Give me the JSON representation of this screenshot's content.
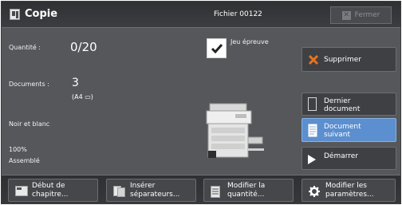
{
  "header": {
    "title": "Copie",
    "file_name": "Fichier 00122",
    "close_label": "Fermer"
  },
  "settings": {
    "quantity_label": "Quantité :",
    "quantity_value": "0/20",
    "documents_label": "Documents :",
    "documents_value": "3",
    "documents_size": "(A4 ▭)",
    "color_mode": "Noir et blanc",
    "zoom": "100%",
    "finishing": "Assemblé",
    "collate_label": "Jeu épreuve",
    "collate_checked": true
  },
  "actions": {
    "delete_label": "Supprimer",
    "last_document_line1": "Dernier",
    "last_document_line2": "document",
    "next_document_line1": "Document",
    "next_document_line2": "suivant",
    "start_label": "Démarrer"
  },
  "bottom": {
    "chapter_start_line1": "Début de",
    "chapter_start_line2": "chapitre...",
    "insert_separators_line1": "Insérer",
    "insert_separators_line2": "séparateurs...",
    "modify_quantity_line1": "Modifier la",
    "modify_quantity_line2": "quantité...",
    "modify_params_line1": "Modifier les",
    "modify_params_line2": "paramètres..."
  },
  "colors": {
    "panel": "#56575b",
    "header": "#303134",
    "selected": "#5b8fcf",
    "delete_accent": "#e8741e"
  }
}
